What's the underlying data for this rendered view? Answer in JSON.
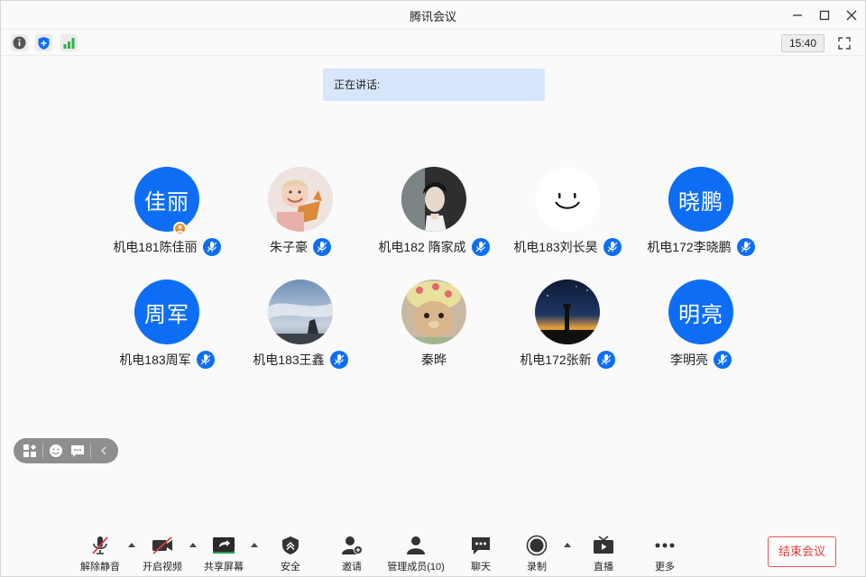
{
  "window": {
    "title": "腾讯会议"
  },
  "status_bar": {
    "time": "15:40"
  },
  "banner": {
    "speaking_label": "正在讲话:"
  },
  "participants": [
    {
      "name": "机电181陈佳丽",
      "avatar_text": "佳丽",
      "avatar": "text",
      "host": true,
      "mic": "muted"
    },
    {
      "name": "朱子豪",
      "avatar_text": "",
      "avatar": "photo-child-with-fox-plush",
      "mic": "muted"
    },
    {
      "name": "机电182 隋家成",
      "avatar_text": "",
      "avatar": "photo-young-man",
      "mic": "muted"
    },
    {
      "name": "机电183刘长昊",
      "avatar_text": "",
      "avatar": "smiley-face",
      "mic": "muted"
    },
    {
      "name": "机电172李晓鹏",
      "avatar_text": "晓鹏",
      "avatar": "text",
      "mic": "muted"
    },
    {
      "name": "机电183周军",
      "avatar_text": "周军",
      "avatar": "text",
      "mic": "muted"
    },
    {
      "name": "机电183王鑫",
      "avatar_text": "",
      "avatar": "photo-sky-clouds",
      "mic": "muted"
    },
    {
      "name": "秦晔",
      "avatar_text": "",
      "avatar": "photo-plush-bear-hat",
      "mic": "none"
    },
    {
      "name": "机电172张新",
      "avatar_text": "",
      "avatar": "photo-lighthouse-sunset",
      "mic": "muted"
    },
    {
      "name": "李明亮",
      "avatar_text": "明亮",
      "avatar": "text",
      "mic": "muted"
    }
  ],
  "toolbar": {
    "unmute": "解除静音",
    "start_video": "开启视频",
    "share_screen": "共享屏幕",
    "security": "安全",
    "invite": "邀请",
    "manage_members": "管理成员(10)",
    "chat": "聊天",
    "record": "录制",
    "live": "直播",
    "more": "更多",
    "end_meeting": "结束会议"
  },
  "colors": {
    "accent": "#0d6ef5",
    "host_badge": "#f08a24",
    "end_button": "#e03b3b",
    "banner_bg": "#d6e6fb"
  }
}
